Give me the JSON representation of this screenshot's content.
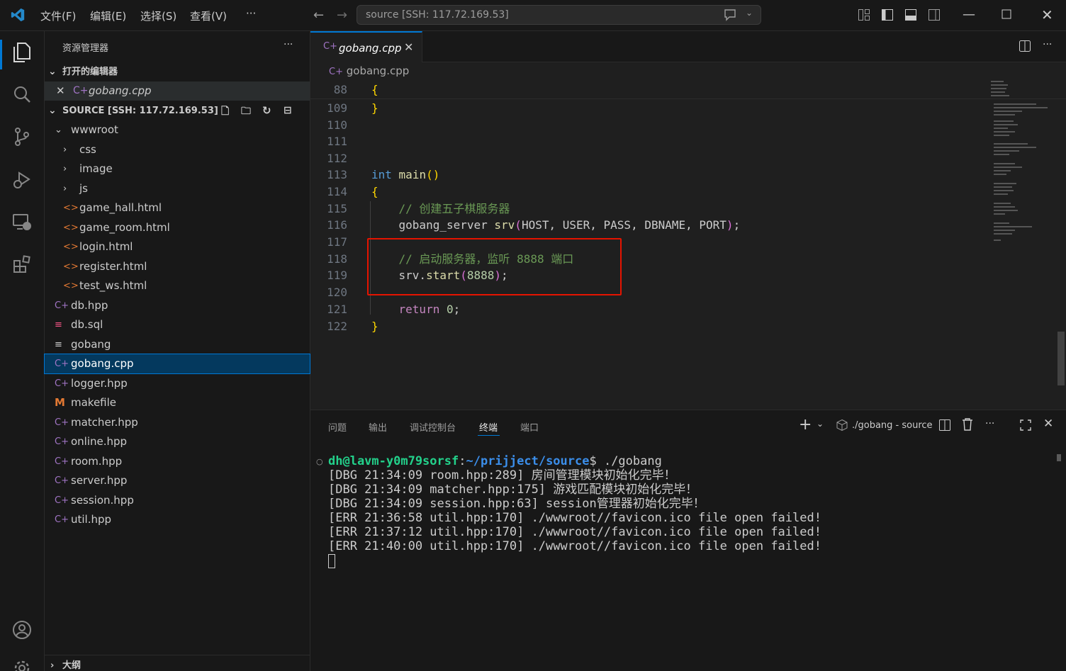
{
  "menu": {
    "file": "文件(F)",
    "edit": "编辑(E)",
    "select": "选择(S)",
    "view": "查看(V)",
    "more": "···"
  },
  "command_center": {
    "text": "source [SSH: 117.72.169.53]"
  },
  "sidebar": {
    "title": "资源管理器",
    "more": "···",
    "open_editors_label": "打开的编辑器",
    "open_editors": [
      {
        "name": "gobang.cpp"
      }
    ],
    "folder_label": "SOURCE [SSH: 117.72.169.53]",
    "tree": [
      {
        "name": "wwwroot",
        "type": "folder-open"
      },
      {
        "name": "css",
        "type": "folder"
      },
      {
        "name": "image",
        "type": "folder"
      },
      {
        "name": "js",
        "type": "folder"
      },
      {
        "name": "game_hall.html",
        "type": "html"
      },
      {
        "name": "game_room.html",
        "type": "html"
      },
      {
        "name": "login.html",
        "type": "html"
      },
      {
        "name": "register.html",
        "type": "html"
      },
      {
        "name": "test_ws.html",
        "type": "html"
      },
      {
        "name": "db.hpp",
        "type": "cpp"
      },
      {
        "name": "db.sql",
        "type": "sql"
      },
      {
        "name": "gobang",
        "type": "text"
      },
      {
        "name": "gobang.cpp",
        "type": "cpp"
      },
      {
        "name": "logger.hpp",
        "type": "cpp"
      },
      {
        "name": "makefile",
        "type": "make"
      },
      {
        "name": "matcher.hpp",
        "type": "cpp"
      },
      {
        "name": "online.hpp",
        "type": "cpp"
      },
      {
        "name": "room.hpp",
        "type": "cpp"
      },
      {
        "name": "server.hpp",
        "type": "cpp"
      },
      {
        "name": "session.hpp",
        "type": "cpp"
      },
      {
        "name": "util.hpp",
        "type": "cpp"
      }
    ],
    "outline_label": "大纲"
  },
  "editor": {
    "tab_label": "gobang.cpp",
    "breadcrumb": "gobang.cpp",
    "lines": [
      {
        "n": "88",
        "parts": [
          [
            "br1",
            "{"
          ]
        ]
      },
      {
        "n": "109",
        "parts": [
          [
            "br1",
            "}"
          ]
        ]
      },
      {
        "n": "110",
        "parts": []
      },
      {
        "n": "111",
        "parts": []
      },
      {
        "n": "112",
        "parts": []
      },
      {
        "n": "113",
        "parts": [
          [
            "kw",
            "int"
          ],
          [
            "var",
            " "
          ],
          [
            "fn",
            "main"
          ],
          [
            "br1",
            "()"
          ]
        ]
      },
      {
        "n": "114",
        "parts": [
          [
            "br1",
            "{"
          ]
        ]
      },
      {
        "n": "115",
        "parts": [
          [
            "var",
            "    "
          ],
          [
            "cm",
            "// 创建五子棋服务器"
          ]
        ]
      },
      {
        "n": "116",
        "parts": [
          [
            "var",
            "    gobang_server "
          ],
          [
            "fn",
            "srv"
          ],
          [
            "br2",
            "("
          ],
          [
            "var",
            "HOST, USER, PASS, DBNAME, PORT"
          ],
          [
            "br2",
            ")"
          ],
          [
            "var",
            ";"
          ]
        ]
      },
      {
        "n": "117",
        "parts": []
      },
      {
        "n": "118",
        "parts": [
          [
            "var",
            "    "
          ],
          [
            "cm",
            "// 启动服务器，监听 8888 端口"
          ]
        ]
      },
      {
        "n": "119",
        "parts": [
          [
            "var",
            "    srv."
          ],
          [
            "fn",
            "start"
          ],
          [
            "br2",
            "("
          ],
          [
            "num",
            "8888"
          ],
          [
            "br2",
            ")"
          ],
          [
            "var",
            ";"
          ]
        ]
      },
      {
        "n": "120",
        "parts": []
      },
      {
        "n": "121",
        "parts": [
          [
            "var",
            "    "
          ],
          [
            "ctrl",
            "return"
          ],
          [
            "var",
            " "
          ],
          [
            "num",
            "0"
          ],
          [
            "var",
            ";"
          ]
        ]
      },
      {
        "n": "122",
        "parts": [
          [
            "br1",
            "}"
          ]
        ]
      }
    ]
  },
  "panel": {
    "tabs": [
      "问题",
      "输出",
      "调试控制台",
      "终端",
      "端口"
    ],
    "active_tab": "终端",
    "terminal_name": "./gobang - source",
    "prompt_user": "dh@lavm-y0m79sorsf",
    "prompt_path": "~/prijject/source",
    "prompt_cmd": "$ ./gobang",
    "output": [
      "[DBG 21:34:09 room.hpp:289] 房间管理模块初始化完毕！",
      "[DBG 21:34:09 matcher.hpp:175] 游戏匹配模块初始化完毕！",
      "[DBG 21:34:09 session.hpp:63] session管理器初始化完毕！",
      "[ERR 21:36:58 util.hpp:170] ./wwwroot//favicon.ico file open failed!",
      "[ERR 21:37:12 util.hpp:170] ./wwwroot//favicon.ico file open failed!",
      "[ERR 21:40:00 util.hpp:170] ./wwwroot//favicon.ico file open failed!"
    ]
  },
  "colors": {
    "accent": "#0078d4",
    "highlight_box": "#e51400",
    "prompt_green": "#23d18b",
    "prompt_blue": "#3b8eea"
  }
}
